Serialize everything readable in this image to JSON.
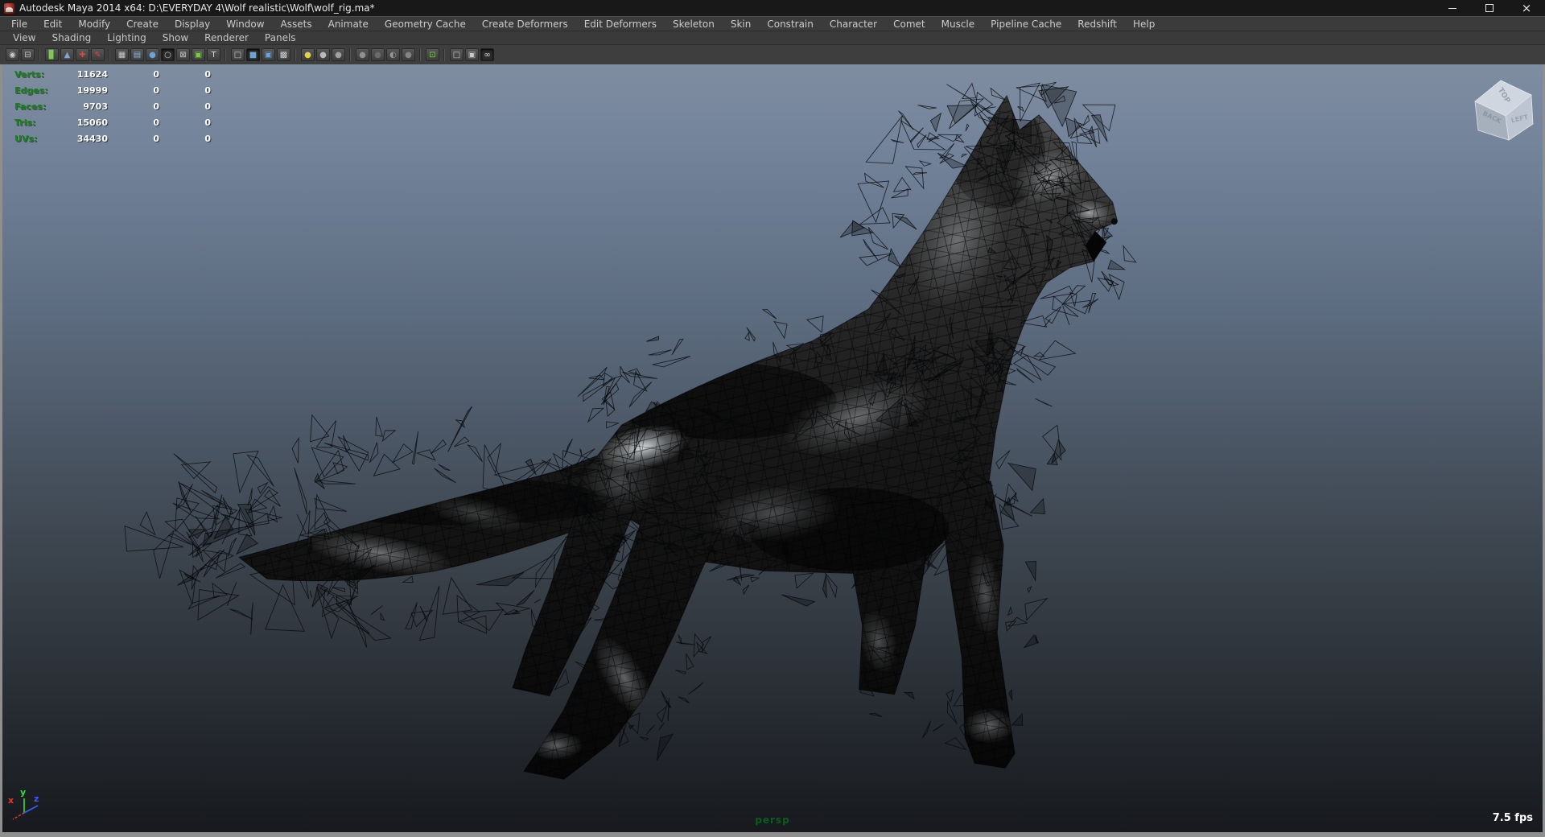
{
  "window": {
    "title": "Autodesk Maya 2014 x64: D:\\EVERYDAY 4\\Wolf realistic\\Wolf\\wolf_rig.ma*",
    "close_glyph": "×"
  },
  "menu_bar": [
    "File",
    "Edit",
    "Modify",
    "Create",
    "Display",
    "Window",
    "Assets",
    "Animate",
    "Geometry Cache",
    "Create Deformers",
    "Edit Deformers",
    "Skeleton",
    "Skin",
    "Constrain",
    "Character",
    "Comet",
    "Muscle",
    "Pipeline Cache",
    "Redshift",
    "Help"
  ],
  "panel_menu": [
    "View",
    "Shading",
    "Lighting",
    "Show",
    "Renderer",
    "Panels"
  ],
  "toolbar": {
    "icons": [
      {
        "name": "select-camera-icon",
        "glyph": "◉",
        "color": "#c9c9c9"
      },
      {
        "name": "camera-attributes-icon",
        "glyph": "⊟",
        "color": "#c9c9c9"
      },
      {
        "sep": true
      },
      {
        "name": "bookmark-icon",
        "glyph": "▊",
        "color": "#7ec850"
      },
      {
        "name": "image-plane-icon",
        "glyph": "▲",
        "color": "#7aa8d8"
      },
      {
        "name": "pan-zoom-icon",
        "glyph": "✚",
        "color": "#d84840"
      },
      {
        "name": "grease-pencil-icon",
        "glyph": "✎",
        "color": "#d84840"
      },
      {
        "sep": true
      },
      {
        "name": "grid-icon",
        "glyph": "▦",
        "color": "#c9c9c9"
      },
      {
        "name": "film-gate-icon",
        "glyph": "▤",
        "color": "#8ab4e0"
      },
      {
        "name": "resolution-gate-icon",
        "glyph": "●",
        "color": "#6aa2dc"
      },
      {
        "name": "gate-mask-icon",
        "glyph": "○",
        "color": "#c9c9c9",
        "pressed": true
      },
      {
        "name": "field-chart-icon",
        "glyph": "⊠",
        "color": "#c9c9c9"
      },
      {
        "name": "safe-action-icon",
        "glyph": "▣",
        "color": "#7ec850"
      },
      {
        "name": "safe-title-icon",
        "glyph": "T",
        "color": "#d8d8d8"
      },
      {
        "sep": true
      },
      {
        "name": "wireframe-icon",
        "glyph": "□",
        "color": "#c9c9c9"
      },
      {
        "name": "shaded-icon",
        "glyph": "■",
        "color": "#6aa2dc",
        "pressed": true
      },
      {
        "name": "wireframe-on-shaded-icon",
        "glyph": "▣",
        "color": "#6aa2dc"
      },
      {
        "name": "textured-icon",
        "glyph": "▩",
        "color": "#d0d0d0"
      },
      {
        "sep": true
      },
      {
        "name": "use-all-lights-icon",
        "glyph": "●",
        "color": "#e6d23c"
      },
      {
        "name": "ambient-light-icon",
        "glyph": "●",
        "color": "#b9b9b9"
      },
      {
        "name": "flat-light-icon",
        "glyph": "●",
        "color": "#a0a0a0"
      },
      {
        "sep": true
      },
      {
        "name": "shadows-icon",
        "glyph": "●",
        "color": "#8f8f8f"
      },
      {
        "name": "ssao-icon",
        "glyph": "●",
        "color": "#6a6a6a"
      },
      {
        "name": "motion-blur-icon",
        "glyph": "◐",
        "color": "#9a9a9a"
      },
      {
        "name": "depth-of-field-icon",
        "glyph": "●",
        "color": "#848484"
      },
      {
        "sep": true
      },
      {
        "name": "isolate-select-icon",
        "glyph": "⊡",
        "color": "#7ec850"
      },
      {
        "sep": true
      },
      {
        "name": "xray-icon",
        "glyph": "□",
        "color": "#c9c9c9"
      },
      {
        "name": "xray-active-components-icon",
        "glyph": "▣",
        "color": "#c9c9c9"
      },
      {
        "name": "link-icon",
        "glyph": "∞",
        "color": "#d8d8d8",
        "pressed": true
      }
    ]
  },
  "hud": {
    "rows": [
      {
        "label": "Verts:",
        "value": "11624",
        "col2": "0",
        "col3": "0"
      },
      {
        "label": "Edges:",
        "value": "19999",
        "col2": "0",
        "col3": "0"
      },
      {
        "label": "Faces:",
        "value": "9703",
        "col2": "0",
        "col3": "0"
      },
      {
        "label": "Tris:",
        "value": "15060",
        "col2": "0",
        "col3": "0"
      },
      {
        "label": "UVs:",
        "value": "34430",
        "col2": "0",
        "col3": "0"
      }
    ]
  },
  "viewport": {
    "camera_label": "persp",
    "fps": "7.5 fps",
    "view_cube": {
      "top_face": "TOP",
      "left_face": "BACK",
      "right_face": "LEFT"
    },
    "axis": {
      "x": "x",
      "y": "y",
      "z": "z"
    }
  },
  "colors": {
    "hud_label_green": "#1b811b",
    "persp_green": "#0c5c20",
    "viewport_top": "#7f8da1",
    "viewport_bottom": "#17191d",
    "axis_x": "#e03a2e",
    "axis_y": "#35e03a",
    "axis_z": "#3b5bff"
  }
}
